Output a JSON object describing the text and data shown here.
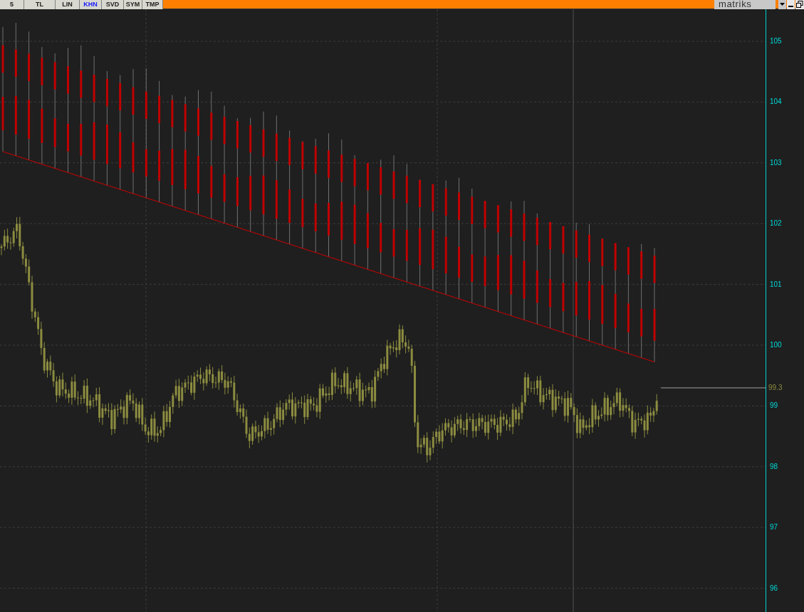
{
  "toolbar": {
    "buttons": [
      {
        "label": "5",
        "selected": false
      },
      {
        "label": "TL",
        "selected": false
      },
      {
        "label": "LIN",
        "selected": false
      },
      {
        "label": "KHN",
        "selected": true
      },
      {
        "label": "SVD",
        "selected": false
      },
      {
        "label": "SYM",
        "selected": false
      },
      {
        "label": "TMP",
        "selected": false
      }
    ],
    "logo": "matriks"
  },
  "chart": {
    "y_axis_ticks": [
      "105",
      "104",
      "103",
      "102",
      "101",
      "100",
      "99",
      "98",
      "97",
      "96"
    ],
    "last_price": "99.3"
  }
}
